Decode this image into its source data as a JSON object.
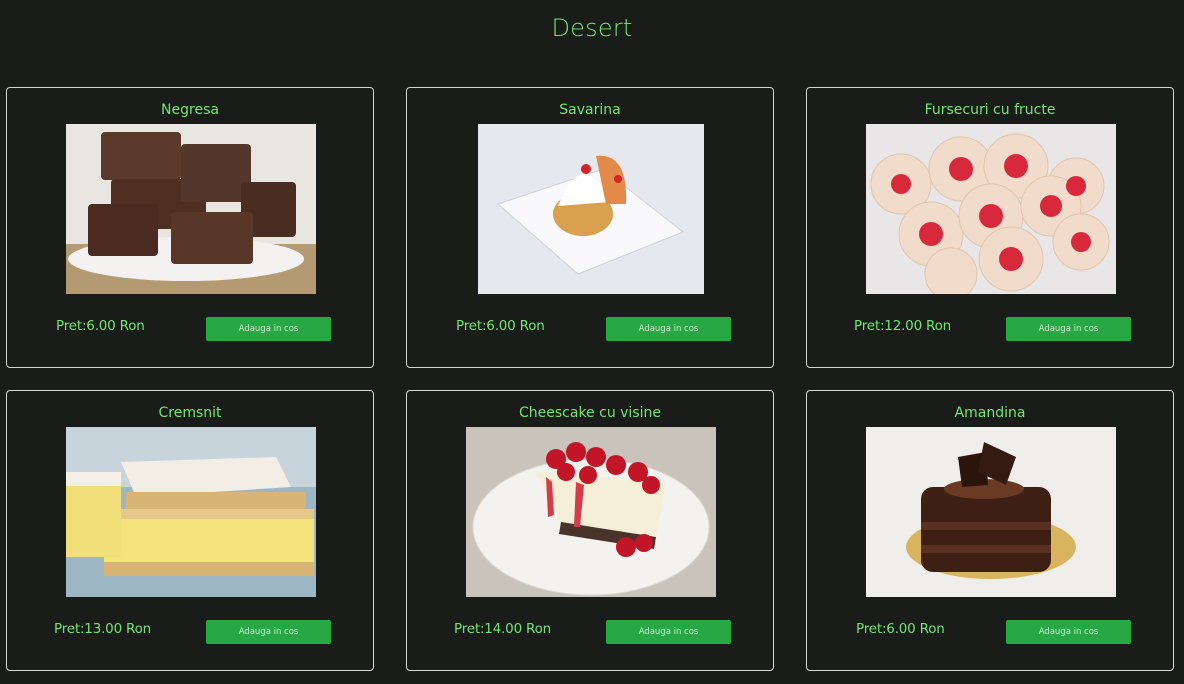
{
  "page": {
    "title": "Desert"
  },
  "products": [
    {
      "name": "Negresa",
      "price": "Pret:6.00 Ron",
      "button": "Adauga in cos",
      "image": "brownies-photo"
    },
    {
      "name": "Savarina",
      "price": "Pret:6.00 Ron",
      "button": "Adauga in cos",
      "image": "savarina-photo"
    },
    {
      "name": "Fursecuri cu fructe",
      "price": "Pret:12.00 Ron",
      "button": "Adauga in cos",
      "image": "cookies-photo"
    },
    {
      "name": "Cremsnit",
      "price": "Pret:13.00 Ron",
      "button": "Adauga in cos",
      "image": "cremsnit-photo"
    },
    {
      "name": "Cheescake cu visine",
      "price": "Pret:14.00 Ron",
      "button": "Adauga in cos",
      "image": "cheesecake-photo"
    },
    {
      "name": "Amandina",
      "price": "Pret:6.00 Ron",
      "button": "Adauga in cos",
      "image": "amandina-photo"
    }
  ],
  "colors": {
    "background": "#1a1c1a",
    "accent_text": "#72e672",
    "button": "#28a745",
    "card_border": "#d6d6d6"
  }
}
